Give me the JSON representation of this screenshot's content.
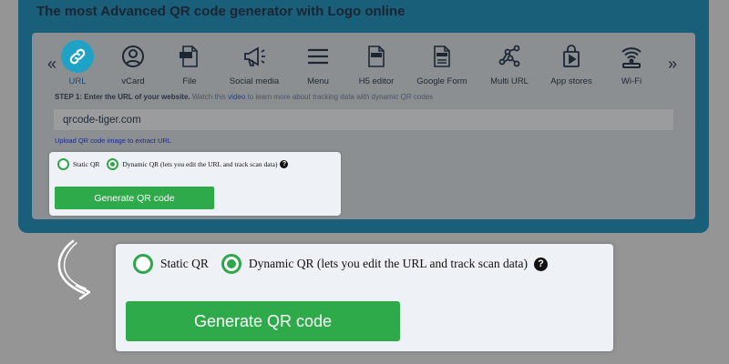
{
  "banner": {
    "title": "The most Advanced QR code generator with Logo online"
  },
  "tabs": [
    {
      "label": "URL",
      "icon": "link-icon",
      "active": true
    },
    {
      "label": "vCard",
      "icon": "user-icon"
    },
    {
      "label": "File",
      "icon": "pdf-file-icon"
    },
    {
      "label": "Social media",
      "icon": "megaphone-icon"
    },
    {
      "label": "Menu",
      "icon": "menu-icon"
    },
    {
      "label": "H5 editor",
      "icon": "html-file-icon"
    },
    {
      "label": "Google Form",
      "icon": "form-icon"
    },
    {
      "label": "Multi URL",
      "icon": "network-icon"
    },
    {
      "label": "App stores",
      "icon": "app-store-icon"
    },
    {
      "label": "Wi-Fi",
      "icon": "wifi-icon"
    }
  ],
  "nav": {
    "prev": "«",
    "next": "»"
  },
  "step": {
    "strong": "STEP 1: Enter the URL of your website.",
    "text_before": " Watch this ",
    "link": "video",
    "text_after": " to learn more about tracking data with dynamic QR codes"
  },
  "url_input": {
    "value": "qrcode-tiger.com"
  },
  "upload_link": "Upload QR code image to extract URL",
  "qr_type": {
    "static_label": "Static QR",
    "dynamic_label": "Dynamic QR (lets you edit the URL and track scan data)",
    "help": "?",
    "selected": "dynamic"
  },
  "generate_label": "Generate QR code",
  "colors": {
    "accent_green": "#2eaa4a",
    "banner": "#1a5f7a",
    "active_tab": "#1fa2c6"
  }
}
